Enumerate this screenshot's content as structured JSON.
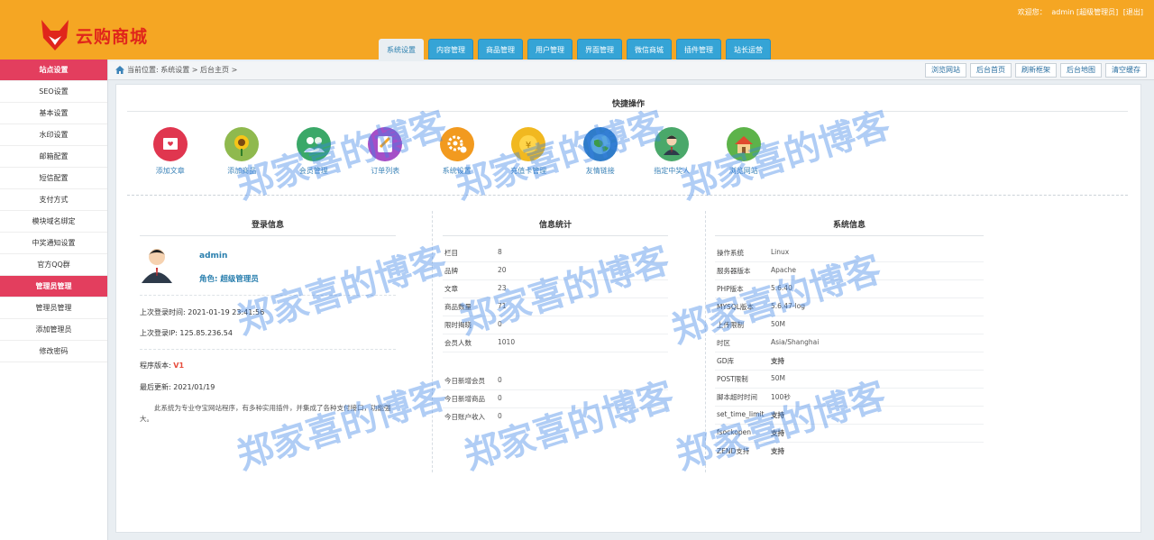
{
  "brand": {
    "logo_text": "云购商城",
    "accent": "#f5a623",
    "sidebar_active": "#e33e5e",
    "tab_color": "#35a4d6"
  },
  "welcome": {
    "prefix": "欢迎您：",
    "user": "admin [超级管理员]",
    "logout": "[退出]"
  },
  "topnav": [
    "系统设置",
    "内容管理",
    "商品管理",
    "用户管理",
    "界面管理",
    "微信商城",
    "插件管理",
    "站长运营"
  ],
  "sidebar": {
    "group1": "站点设置",
    "items1": [
      "SEO设置",
      "基本设置",
      "水印设置",
      "邮箱配置",
      "短信配置",
      "支付方式",
      "模块域名绑定",
      "中奖通知设置",
      "官方QQ群"
    ],
    "group2": "管理员管理",
    "items2": [
      "管理员管理",
      "添加管理员",
      "修改密码"
    ]
  },
  "breadcrumb": {
    "text": "当前位置: 系统设置 > 后台主页 >"
  },
  "toolbar": [
    "浏览网站",
    "后台首页",
    "刷新框架",
    "后台地图",
    "清空缓存"
  ],
  "quick": {
    "title": "快捷操作",
    "items": [
      {
        "label": "添加文章",
        "icon": "article-icon",
        "color": "#e0364f"
      },
      {
        "label": "添加商品",
        "icon": "sunflower-icon",
        "color": "#8fb94e"
      },
      {
        "label": "会员管理",
        "icon": "members-icon",
        "color": "#3aa868"
      },
      {
        "label": "订单列表",
        "icon": "order-list-icon",
        "color": "#a54fc7"
      },
      {
        "label": "系统设置",
        "icon": "gear-icon",
        "color": "#f29a1f"
      },
      {
        "label": "充值卡管理",
        "icon": "card-icon",
        "color": "#f1b820"
      },
      {
        "label": "友情链接",
        "icon": "globe-icon",
        "color": "#2f7cc9"
      },
      {
        "label": "指定中奖人",
        "icon": "winner-icon",
        "color": "#4aa86a"
      },
      {
        "label": "浏览网站",
        "icon": "house-icon",
        "color": "#5db34a"
      }
    ]
  },
  "login": {
    "title": "登录信息",
    "username": "admin",
    "role": "角色: 超级管理员",
    "last_time": "上次登录时间: 2021-01-19 23:41:56",
    "last_ip": "上次登录IP: 125.85.236.54",
    "version_label": "程序版本:",
    "version": "V1",
    "updated": "最后更新: 2021/01/19",
    "description": "此系统为专业夺宝网站程序，有多种实用插件，并集成了各种支付接口，功能强大。"
  },
  "stats": {
    "title": "信息统计",
    "rows": [
      {
        "k": "栏目",
        "v": "8"
      },
      {
        "k": "品牌",
        "v": "20"
      },
      {
        "k": "文章",
        "v": "23"
      },
      {
        "k": "商品数量",
        "v": "71"
      },
      {
        "k": "限时揭晓",
        "v": "0"
      },
      {
        "k": "会员人数",
        "v": "1010"
      }
    ],
    "today": [
      {
        "k": "今日新增会员",
        "v": "0"
      },
      {
        "k": "今日新增商品",
        "v": "0"
      },
      {
        "k": "今日账户收入",
        "v": "0"
      }
    ]
  },
  "system": {
    "title": "系统信息",
    "rows": [
      {
        "k": "操作系统",
        "v": "Linux"
      },
      {
        "k": "服务器版本",
        "v": "Apache"
      },
      {
        "k": "PHP版本",
        "v": "5.6.40"
      },
      {
        "k": "MYSQL版本",
        "v": "5.6.47-log"
      },
      {
        "k": "上传限制",
        "v": "50M"
      },
      {
        "k": "时区",
        "v": "Asia/Shanghai"
      },
      {
        "k": "GD库",
        "v": "支持"
      },
      {
        "k": "POST限制",
        "v": "50M"
      },
      {
        "k": "脚本超时时间",
        "v": "100秒"
      },
      {
        "k": "set_time_limit",
        "v": "支持"
      },
      {
        "k": "fsockopen",
        "v": "支持"
      },
      {
        "k": "ZEND支持",
        "v": "支持"
      }
    ]
  },
  "watermark": "郑家喜的博客"
}
